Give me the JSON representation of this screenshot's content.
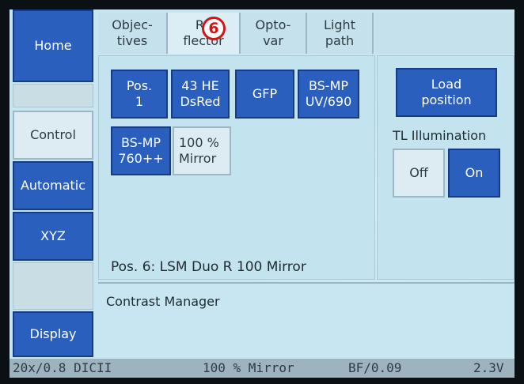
{
  "badge": "6",
  "sidebar": {
    "items": [
      {
        "label": "Home"
      },
      {
        "label": "Control"
      },
      {
        "label": "Automatic"
      },
      {
        "label": "XYZ"
      },
      {
        "label": "Display"
      }
    ]
  },
  "tabs": [
    {
      "label": "Objec-\ntives"
    },
    {
      "label": "Re\nflector"
    },
    {
      "label": "Opto-\nvar"
    },
    {
      "label": "Light\npath"
    }
  ],
  "reflector": {
    "positions": [
      {
        "label": "Pos.\n1"
      },
      {
        "label": "43 HE\nDsRed"
      },
      {
        "label": "GFP"
      },
      {
        "label": "BS-MP\nUV/690"
      },
      {
        "label": "BS-MP\n760++"
      },
      {
        "label": "100 %\nMirror"
      }
    ],
    "current": "Pos. 6: LSM Duo R 100 Mirror"
  },
  "right": {
    "load_position": "Load\nposition",
    "tl_label": "TL Illumination",
    "off": "Off",
    "on": "On"
  },
  "contrast_manager": {
    "title": "Contrast Manager"
  },
  "statusbar": {
    "objective": "20x/0.8 DICII",
    "reflector": "100 % Mirror",
    "contrast": "BF/0.09",
    "voltage": "2.3V"
  },
  "colors": {
    "button_blue": "#2b5fbe",
    "screen_bg": "#c7e6f2",
    "badge_red": "#d0141a"
  }
}
